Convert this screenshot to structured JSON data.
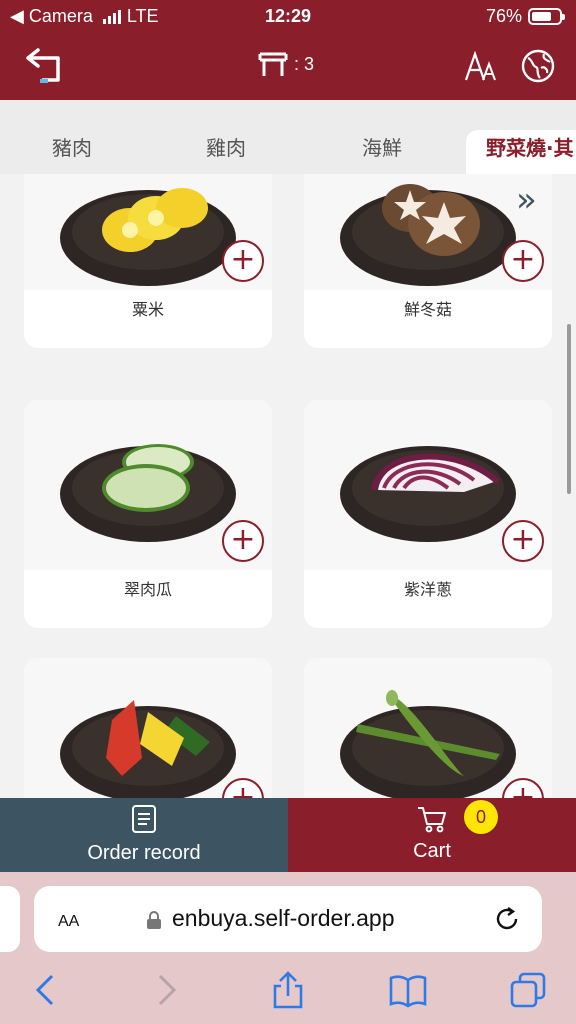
{
  "status_bar": {
    "back_app": "◀ Camera",
    "network": "LTE",
    "time": "12:29",
    "battery": "76%",
    "battery_level": 0.76
  },
  "header": {
    "back_icon": "return-arrow-icon",
    "table_label": ": 3",
    "table_icon": "table-icon",
    "font_icon": "font-size-icon",
    "language_icon": "globe-icon"
  },
  "tabs": [
    {
      "label": "豬肉",
      "active": false
    },
    {
      "label": "雞肉",
      "active": false
    },
    {
      "label": "海鮮",
      "active": false
    },
    {
      "label": "野菜燒·其",
      "active": true
    }
  ],
  "more_tabs_icon": "double-chevron-right-icon",
  "menu_items": [
    {
      "name": "粟米"
    },
    {
      "name": "鮮冬菇"
    },
    {
      "name": "翠肉瓜"
    },
    {
      "name": "紫洋蔥"
    },
    {
      "name": ""
    },
    {
      "name": ""
    }
  ],
  "add_label": "+",
  "bottom_bar": {
    "order_record_label": "Order record",
    "cart_label": "Cart",
    "cart_count": "0"
  },
  "safari": {
    "aa_label": "AA",
    "url": "enbuya.self-order.app"
  },
  "colors": {
    "brand": "#8b1e2b",
    "secondary": "#3d5563",
    "badge": "#ffe600"
  }
}
